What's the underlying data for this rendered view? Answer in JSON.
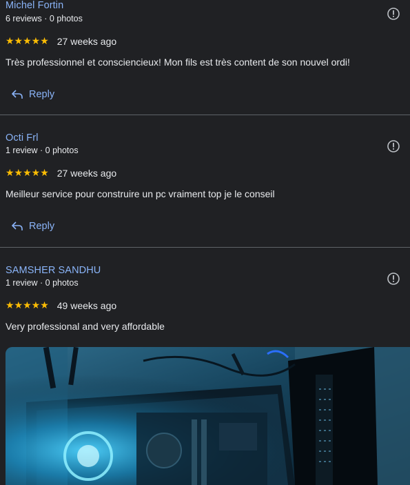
{
  "reviews": [
    {
      "name": "Michel Fortin",
      "meta": "6 reviews · 0 photos",
      "stars": "★★★★★",
      "time": "27 weeks ago",
      "text": "Très professionnel et consciencieux! Mon fils est très content de son nouvel ordi!",
      "reply_label": "Reply"
    },
    {
      "name": "Octi Frl",
      "meta": "1 review · 0 photos",
      "stars": "★★★★★",
      "time": "27 weeks ago",
      "text": "Meilleur service pour construire un pc vraiment top je le conseil",
      "reply_label": "Reply"
    },
    {
      "name": "SAMSHER SANDHU",
      "meta": "1 review · 0 photos",
      "stars": "★★★★★",
      "time": "49 weeks ago",
      "text": "Very professional and very affordable"
    }
  ],
  "rating_value": 5,
  "colors": {
    "background": "#202124",
    "link": "#8ab4f8",
    "star": "#fbbc04",
    "text": "#e8eaed",
    "divider": "#5f6368"
  },
  "icons": {
    "flag": "report-flag-icon",
    "reply": "reply-arrow-icon",
    "photo": "review-photo"
  }
}
